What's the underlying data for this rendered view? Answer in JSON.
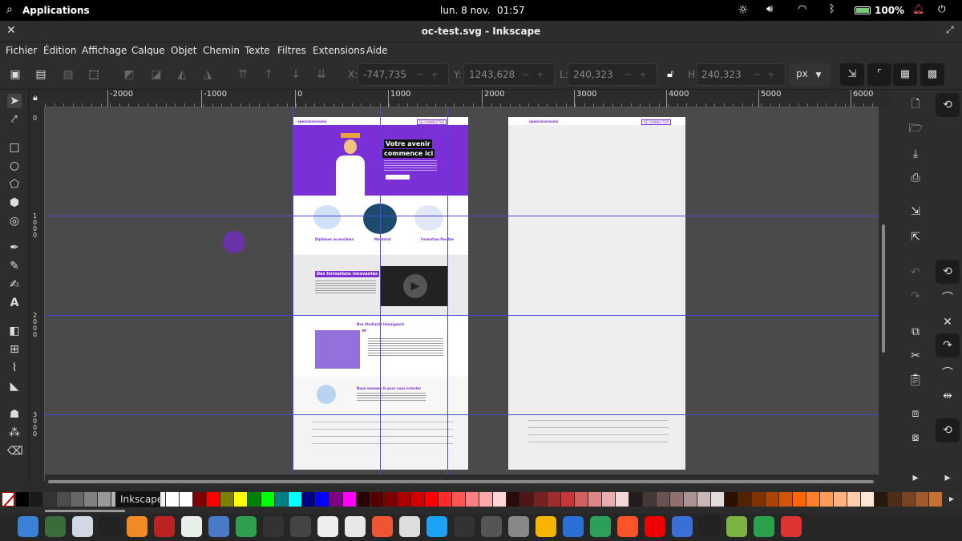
{
  "system_bar": {
    "apps": "Applications",
    "date": "lun.  8 nov.",
    "time": "01:57",
    "battery": "100%"
  },
  "window": {
    "title": "oc-test.svg - Inkscape"
  },
  "menu": [
    "Fichier",
    "Édition",
    "Affichage",
    "Calque",
    "Objet",
    "Chemin",
    "Texte",
    "Filtres",
    "Extensions",
    "Aide"
  ],
  "coords": {
    "x_label": "X:",
    "x_value": "-747,735",
    "y_label": "Y:",
    "y_value": "1243,628",
    "w_label": "L:",
    "w_value": "240,323",
    "h_label": "H:",
    "h_value": "240,323",
    "unit": "px"
  },
  "ruler": {
    "h_ticks": [
      "-2000",
      "-1000",
      "0",
      "1000",
      "2000",
      "3000",
      "4000",
      "5000",
      "6000"
    ],
    "v_ticks": [
      "0",
      "1000",
      "2000",
      "3000"
    ]
  },
  "mockup": {
    "hero_title_1": "Votre avenir",
    "hero_title_2": "commence ici",
    "feature_1": "Diplômes accessibles",
    "feature_2": "Mentorat",
    "feature_3": "Formation flexible",
    "section_title": "Des formations innovantes",
    "testimonial_title": "Nos étudiants témoignent",
    "orient_title": "Nous sommes là pour vous orienter",
    "login": "SE CONNECTER"
  },
  "palette_tooltip": "Inkscape",
  "colors": {
    "accent": "#7b2fd6",
    "guide": "#4a4ad8",
    "canvas": "#4a4a4a"
  }
}
